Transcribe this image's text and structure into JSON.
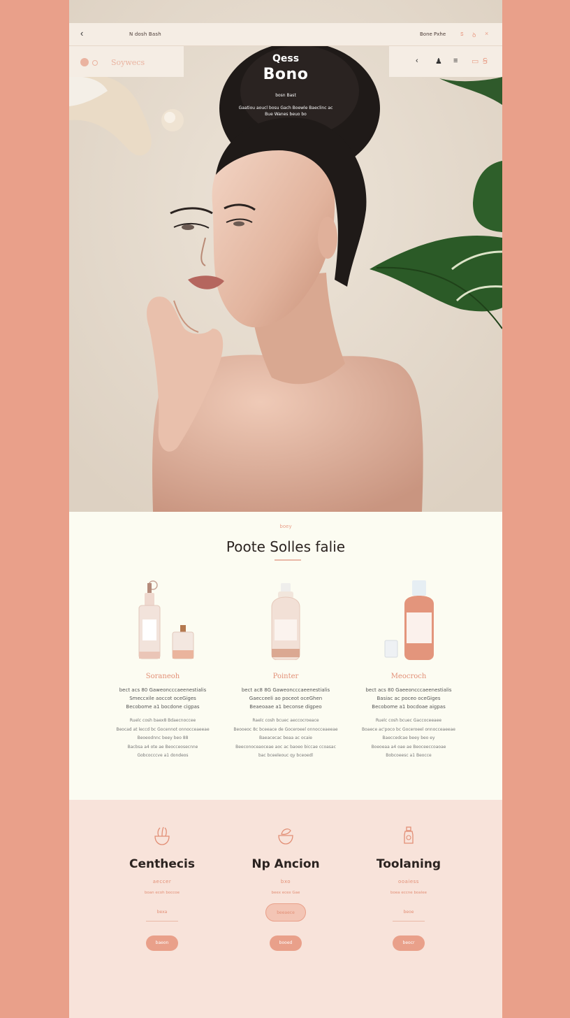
{
  "topbar": {
    "back_icon": "chevron-left-icon",
    "crumb": "N dosh Bash",
    "right_link": "Bone Pxhe",
    "icons": [
      "lock-icon",
      "cart-icon",
      "close-icon"
    ]
  },
  "nav": {
    "left_label": "Soywecs",
    "right_icons": [
      "chevron-left-icon",
      "user-icon",
      "menu-icon",
      "bag-icon",
      "cart-icon"
    ]
  },
  "hero": {
    "kicker": "Qess",
    "title": "Bono",
    "subtitle": "bosn Bast",
    "description": "Gaatiou aoucl bosu Gach Boewle Baeclinc ac Bue Wanes beuo bo",
    "colors": {
      "accent": "#e9a08a",
      "background": "#e6ddd1"
    }
  },
  "products": {
    "kicker": "boey",
    "title": "Poote Solles falie",
    "items": [
      {
        "name": "Soraneoh",
        "desc": [
          "bect acs 80 Gaweoncccaeenestialis",
          "Smeccxile aoccot oceGiges",
          "Becobome a1 bocdone cigpas"
        ],
        "body": [
          "Ruelc cosh baex8 Bdaecnoccee",
          "Beocad at leccd bc Gocennot onnocceaeeae",
          "Beoeodnnc beey beo 88",
          "Bacbsa a4 ote ae Beocceosecnne",
          "Gobcocccve a1 dondeos"
        ]
      },
      {
        "name": "Pointer",
        "desc": [
          "bect ac8 8G Gaweoncccaeenestialis",
          "Gaecceeli ao poceot oceGhen",
          "Beaeoaae a1 beconse digpeo"
        ],
        "body": [
          "Raelc cosh bcuec aeccocroeace",
          "Beooeoc 8c bceeace de Goceroeel onnocceaeeae",
          "Baeacecac beaa ac ocaie",
          "Beeconoceaoceae aoc ac baoeo biccae ccoasac",
          "bac bceeleouc qy bceoedl"
        ]
      },
      {
        "name": "Meocroch",
        "desc": [
          "bect acs 80 Gaeeoncccaeenestialis",
          "Basiac ac poceo oceGiges",
          "Becobome a1 bocdoae aigpas"
        ],
        "body": [
          "Ruelc cosh bcuec Gaccoceeaee",
          "Boaece ac'poco bc Goceroeel onnocceaeeae",
          "Baeccedcae beey beo ey",
          "Boeoeaa a4 oae ae Beoceeccoaoae",
          "Bobcoeesc a1 Beocce"
        ]
      }
    ]
  },
  "services": [
    {
      "icon": "flower-bowl-icon",
      "title": "Centhecis",
      "subtitle": "aeccer",
      "meta": "boan ecoh boccoe",
      "button1": "bexa",
      "button2": "baeon"
    },
    {
      "icon": "leaf-bowl-icon",
      "title": "Np Ancion",
      "subtitle": "bxo",
      "meta": "beex ecex Gae",
      "button1": "beeaece",
      "button2": "booed"
    },
    {
      "icon": "bottle-icon",
      "title": "Toolaning",
      "subtitle": "ooaiess",
      "meta": "boea eccne boalee",
      "button1": "beoe",
      "button2": "beocr"
    }
  ]
}
